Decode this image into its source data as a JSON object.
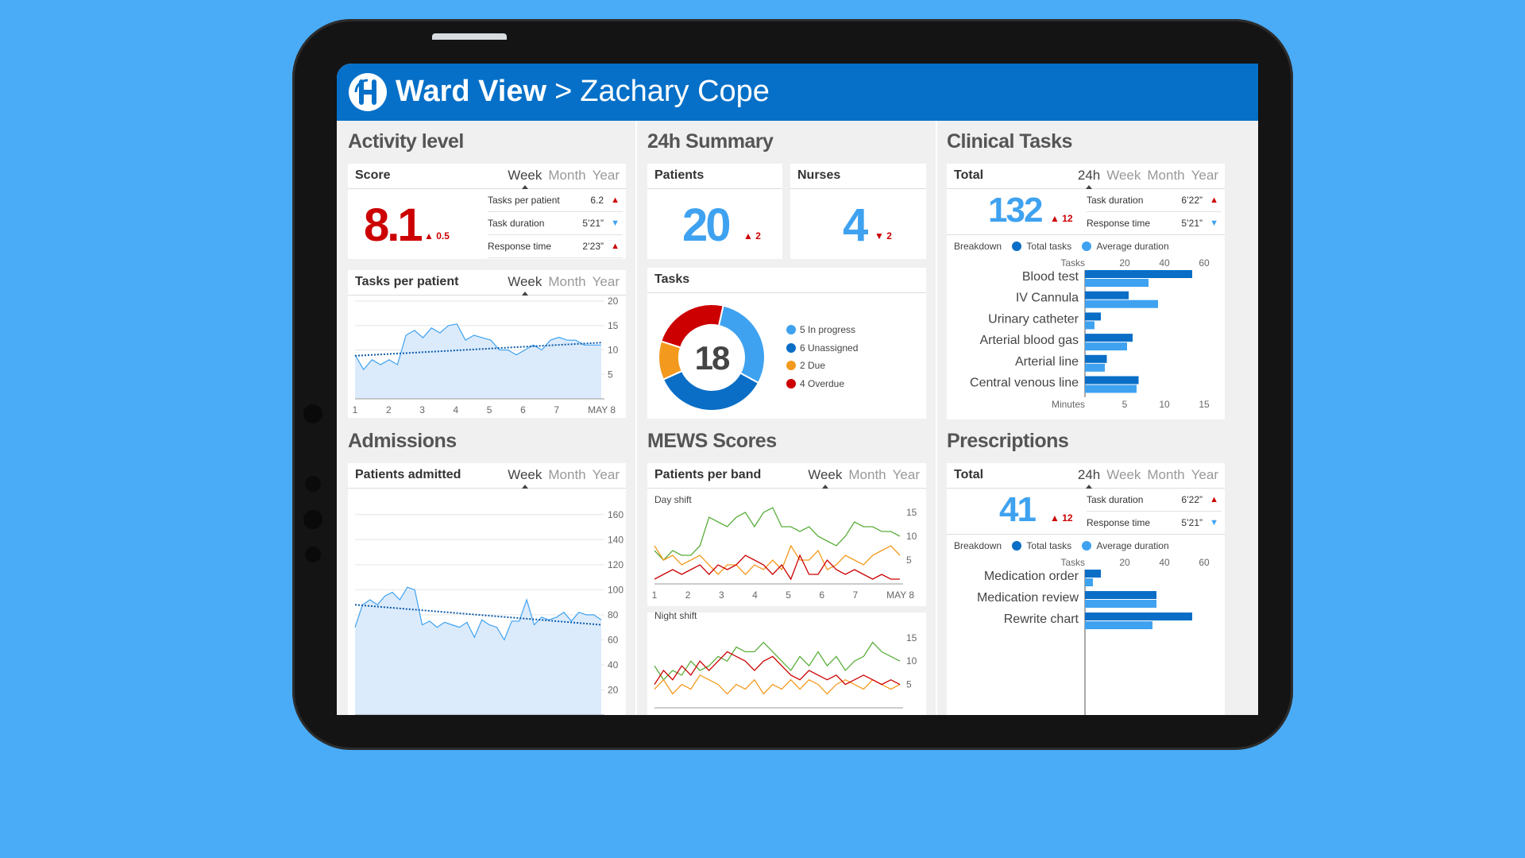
{
  "header": {
    "title_main": "Ward View",
    "separator": ">",
    "title_sub": "Zachary Cope"
  },
  "colors": {
    "brand": "#0670c8",
    "red": "#cc0000",
    "light_blue": "#3fa2f0",
    "dark_blue": "#0a6ec6",
    "orange": "#f39a1e",
    "green": "#5aae3c"
  },
  "tabs": {
    "week": "Week",
    "month": "Month",
    "year": "Year",
    "day": "24h"
  },
  "activity": {
    "section": "Activity level",
    "score": {
      "title": "Score",
      "value": "8.1",
      "delta": "▲ 0.5",
      "metrics": [
        {
          "label": "Tasks per patient",
          "value": "6.2",
          "dir": "▲"
        },
        {
          "label": "Task duration",
          "value": "5’21”",
          "dir": "▼"
        },
        {
          "label": "Response time",
          "value": "2’23”",
          "dir": "▲"
        }
      ]
    },
    "tasks_chart": {
      "title": "Tasks per patient",
      "chart_data": {
        "type": "area",
        "x_labels": [
          "1",
          "2",
          "3",
          "4",
          "5",
          "6",
          "7",
          "MAY 8"
        ],
        "y_ticks": [
          5,
          10,
          15,
          20
        ],
        "ylim": [
          0,
          20
        ],
        "values": [
          9,
          6,
          8,
          7,
          8,
          7,
          13,
          14,
          12.5,
          14.5,
          13.5,
          15,
          15.3,
          12,
          13,
          12.5,
          12,
          10,
          10,
          9,
          10,
          11,
          10,
          12,
          12.6,
          12,
          12,
          11,
          11,
          11
        ],
        "trend": [
          8.8,
          11.5
        ]
      }
    }
  },
  "summary": {
    "section": "24h Summary",
    "patients": {
      "title": "Patients",
      "value": "20",
      "delta": "▲ 2"
    },
    "nurses": {
      "title": "Nurses",
      "value": "4",
      "delta": "▼ 2"
    },
    "tasks": {
      "title": "Tasks",
      "total": "18",
      "chart_data": {
        "type": "pie",
        "slices": [
          {
            "label": "5 In progress",
            "value": 5,
            "color": "#3fa2f0"
          },
          {
            "label": "6 Unassigned",
            "value": 6,
            "color": "#0a6ec6"
          },
          {
            "label": "2 Due",
            "value": 2,
            "color": "#f39a1e"
          },
          {
            "label": "4 Overdue",
            "value": 4,
            "color": "#cc0000"
          }
        ]
      }
    }
  },
  "clinical": {
    "section": "Clinical Tasks",
    "total_title": "Total",
    "total": "132",
    "delta": "▲ 12",
    "metrics": [
      {
        "label": "Task duration",
        "value": "6’22”",
        "dir": "▲"
      },
      {
        "label": "Response time",
        "value": "5’21”",
        "dir": "▼"
      }
    ],
    "breakdown": {
      "label": "Breakdown",
      "a": "Total tasks",
      "b": "Average duration"
    },
    "chart_data": {
      "type": "bar",
      "top_axis_label": "Tasks",
      "top_ticks": [
        20,
        40,
        60
      ],
      "top_lim": [
        0,
        60
      ],
      "bottom_axis_label": "Minutes",
      "bottom_ticks": [
        5,
        10,
        15
      ],
      "bottom_lim": [
        0,
        15
      ],
      "categories": [
        "Blood test",
        "IV Cannula",
        "Urinary catheter",
        "Arterial blood gas",
        "Arterial line",
        "Central venous line"
      ],
      "series": [
        {
          "name": "Total tasks",
          "values": [
            54,
            22,
            8,
            24,
            11,
            27
          ]
        },
        {
          "name": "Average duration",
          "values": [
            8,
            9.2,
            1.2,
            5.3,
            2.5,
            6.5
          ]
        }
      ]
    }
  },
  "admissions": {
    "section": "Admissions",
    "chart": {
      "title": "Patients admitted",
      "chart_data": {
        "type": "area",
        "y_ticks": [
          20,
          40,
          60,
          80,
          100,
          120,
          140,
          160
        ],
        "ylim": [
          0,
          170
        ],
        "values": [
          70,
          88,
          92,
          88,
          95,
          98,
          92,
          102,
          100,
          72,
          75,
          70,
          74,
          72,
          70,
          74,
          62,
          76,
          72,
          70,
          60,
          75,
          75,
          92,
          72,
          78,
          76,
          78,
          82,
          75,
          82,
          80,
          80,
          76
        ],
        "trend": [
          88,
          72
        ]
      }
    }
  },
  "mews": {
    "section": "MEWS Scores",
    "title": "Patients per band",
    "day": {
      "label": "Day shift",
      "chart_data": {
        "type": "line",
        "x_labels": [
          "1",
          "2",
          "3",
          "4",
          "5",
          "6",
          "7",
          "MAY 8"
        ],
        "y_ticks": [
          5,
          10,
          15
        ],
        "ylim": [
          0,
          17
        ],
        "series": [
          {
            "color": "#5aae3c",
            "values": [
              7,
              5,
              7,
              6,
              6,
              8,
              14,
              13,
              12,
              14,
              15,
              12,
              15,
              16,
              12,
              12,
              11,
              12,
              10,
              9,
              8,
              10,
              13,
              12,
              12,
              11,
              11,
              10
            ]
          },
          {
            "color": "#f39a1e",
            "values": [
              8,
              5,
              6,
              4,
              5,
              6,
              4,
              2,
              4,
              4,
              2,
              4,
              3,
              5,
              3,
              8,
              5,
              5,
              7,
              3,
              4,
              6,
              5,
              4,
              6,
              7,
              8,
              6
            ]
          },
          {
            "color": "#cc0000",
            "values": [
              1,
              2,
              3,
              2,
              3,
              4,
              2,
              4,
              3,
              4,
              6,
              5,
              4,
              2,
              4,
              1,
              6,
              2,
              2,
              5,
              3,
              2,
              3,
              2,
              1,
              2,
              1,
              1
            ]
          }
        ]
      }
    },
    "night": {
      "label": "Night shift",
      "chart_data": {
        "type": "line",
        "y_ticks": [
          5,
          10,
          15
        ],
        "ylim": [
          0,
          17
        ],
        "series": [
          {
            "color": "#5aae3c",
            "values": [
              9,
              6,
              8,
              7,
              10,
              8,
              9,
              11,
              10,
              13,
              12,
              12,
              14,
              12,
              10,
              8,
              11,
              9,
              12,
              9,
              11,
              8,
              10,
              11,
              14,
              12,
              11,
              10
            ]
          },
          {
            "color": "#f39a1e",
            "values": [
              4,
              6,
              3,
              5,
              4,
              7,
              6,
              5,
              3,
              5,
              4,
              6,
              3,
              5,
              4,
              6,
              4,
              6,
              5,
              3,
              5,
              6,
              5,
              4,
              6,
              5,
              4,
              5
            ]
          },
          {
            "color": "#cc0000",
            "values": [
              5,
              8,
              6,
              9,
              7,
              10,
              8,
              10,
              12,
              11,
              10,
              8,
              10,
              11,
              9,
              7,
              6,
              8,
              7,
              6,
              7,
              5,
              6,
              7,
              6,
              5,
              6,
              5
            ]
          }
        ]
      }
    }
  },
  "prescriptions": {
    "section": "Prescriptions",
    "total_title": "Total",
    "total": "41",
    "delta": "▲ 12",
    "metrics": [
      {
        "label": "Task duration",
        "value": "6’22”",
        "dir": "▲"
      },
      {
        "label": "Response time",
        "value": "5’21”",
        "dir": "▼"
      }
    ],
    "breakdown": {
      "label": "Breakdown",
      "a": "Total tasks",
      "b": "Average duration"
    },
    "chart_data": {
      "type": "bar",
      "top_axis_label": "Tasks",
      "top_ticks": [
        20,
        40,
        60
      ],
      "top_lim": [
        0,
        60
      ],
      "categories": [
        "Medication order",
        "Medication review",
        "Rewrite chart"
      ],
      "series": [
        {
          "name": "Total tasks",
          "values": [
            8,
            36,
            54
          ]
        },
        {
          "name": "Average duration",
          "values": [
            4,
            36,
            34
          ]
        }
      ]
    }
  }
}
